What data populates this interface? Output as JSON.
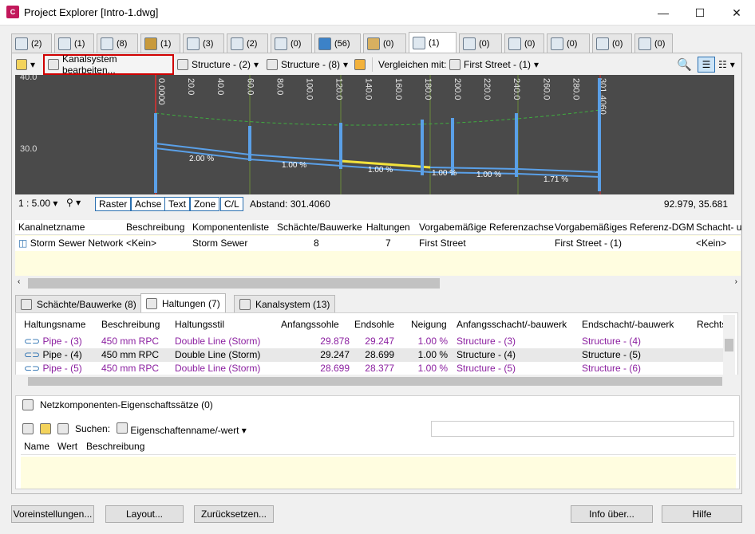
{
  "window": {
    "title": "Project Explorer [Intro-1.dwg]",
    "app_icon": "C",
    "min": "—",
    "max": "☐",
    "close": "✕"
  },
  "tabs": [
    {
      "count": "(2)"
    },
    {
      "count": "(1)"
    },
    {
      "count": "(8)"
    },
    {
      "count": "(1)"
    },
    {
      "count": "(3)"
    },
    {
      "count": "(2)"
    },
    {
      "count": "(0)"
    },
    {
      "count": "(56)"
    },
    {
      "count": "(0)"
    },
    {
      "count": "(1)"
    },
    {
      "count": "(0)"
    },
    {
      "count": "(0)"
    },
    {
      "count": "(0)"
    },
    {
      "count": "(0)"
    },
    {
      "count": "(0)"
    }
  ],
  "toolbar": {
    "edit_network": "Kanalsystem bearbeiten...",
    "structure1": "Structure - (2)",
    "structure2": "Structure - (8)",
    "compare_label": "Vergleichen mit:",
    "compare_value": "First Street - (1)"
  },
  "profile": {
    "y_top": "40.0",
    "y_mid": "30.0",
    "stations": [
      "0.0000",
      "20.0",
      "40.0",
      "60.0",
      "80.0",
      "100.0",
      "120.0",
      "140.0",
      "160.0",
      "180.0",
      "200.0",
      "220.0",
      "240.0",
      "260.0",
      "280.0",
      "301.4060"
    ],
    "slopes": [
      "2.00 %",
      "1.00 %",
      "1.00 %",
      "1.00 %",
      "1.00 %",
      "1.71 %"
    ]
  },
  "profile_status": {
    "scale": "1 : 5.00",
    "buttons": [
      "Raster",
      "Achse",
      "Text",
      "Zone",
      "C/L"
    ],
    "distance": "Abstand: 301.4060",
    "coords": "92.979, 35.681"
  },
  "network_table": {
    "headers": [
      "Kanalnetzname",
      "Beschreibung",
      "Komponentenliste",
      "Schächte/Bauwerke",
      "Haltungen",
      "Vorgabemäßige Referenzachse",
      "Vorgabemäßiges Referenz-DGM",
      "Schacht- u"
    ],
    "row": [
      "Storm Sewer Network",
      "<Kein>",
      "Storm Sewer",
      "8",
      "7",
      "First Street",
      "First Street - (1)",
      "<Kein>"
    ]
  },
  "subtabs": {
    "structures": "Schächte/Bauwerke (8)",
    "pipes": "Haltungen (7)",
    "network": "Kanalsystem (13)"
  },
  "pipes_table": {
    "headers": [
      "Haltungsname",
      "Beschreibung",
      "Haltungsstil",
      "Anfangssohle",
      "Endsohle",
      "Neigung",
      "Anfangsschacht/-bauwerk",
      "Endschacht/-bauwerk",
      "Rechts"
    ],
    "rows": [
      [
        "Pipe - (3)",
        "450 mm RPC",
        "Double Line (Storm)",
        "29.878",
        "29.247",
        "1.00 %",
        "Structure - (3)",
        "Structure - (4)"
      ],
      [
        "Pipe - (4)",
        "450 mm RPC",
        "Double Line (Storm)",
        "29.247",
        "28.699",
        "1.00 %",
        "Structure - (4)",
        "Structure - (5)"
      ],
      [
        "Pipe - (5)",
        "450 mm RPC",
        "Double Line (Storm)",
        "28.699",
        "28.377",
        "1.00 %",
        "Structure - (5)",
        "Structure - (6)"
      ]
    ]
  },
  "props": {
    "tab": "Netzkomponenten-Eigenschaftssätze (0)",
    "search_label": "Suchen:",
    "search_value": "Eigenschaftenname/-wert",
    "headers": [
      "Name",
      "Wert",
      "Beschreibung"
    ]
  },
  "footer": {
    "presets": "Voreinstellungen...",
    "layout": "Layout...",
    "reset": "Zurücksetzen...",
    "about": "Info über...",
    "help": "Hilfe"
  }
}
